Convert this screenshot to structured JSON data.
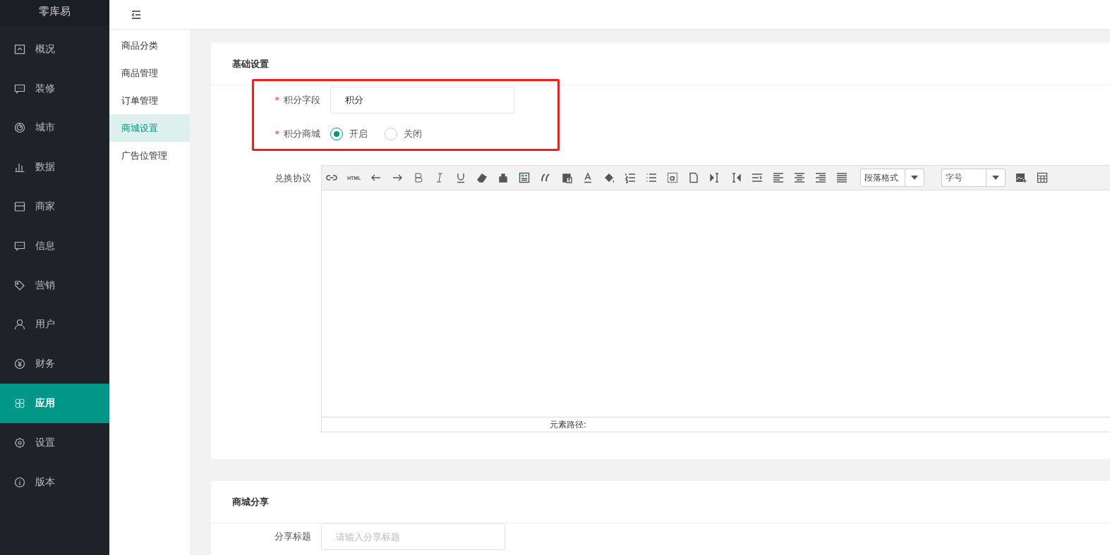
{
  "brand": "零库易",
  "nav": [
    {
      "label": "概况",
      "selected": false
    },
    {
      "label": "装修",
      "selected": false
    },
    {
      "label": "城市",
      "selected": false
    },
    {
      "label": "数据",
      "selected": false
    },
    {
      "label": "商家",
      "selected": false
    },
    {
      "label": "信息",
      "selected": false
    },
    {
      "label": "营销",
      "selected": false
    },
    {
      "label": "用户",
      "selected": false
    },
    {
      "label": "财务",
      "selected": false
    },
    {
      "label": "应用",
      "selected": true
    },
    {
      "label": "设置",
      "selected": false
    },
    {
      "label": "版本",
      "selected": false
    }
  ],
  "subnav": [
    {
      "label": "商品分类",
      "selected": false
    },
    {
      "label": "商品管理",
      "selected": false
    },
    {
      "label": "订单管理",
      "selected": false
    },
    {
      "label": "商城设置",
      "selected": true
    },
    {
      "label": "广告位管理",
      "selected": false
    }
  ],
  "basic": {
    "title": "基础设置",
    "points_field": {
      "label": "积分字段",
      "required_mark": "*",
      "value": "积分"
    },
    "points_mall": {
      "label": "积分商城",
      "required_mark": "*",
      "options": [
        {
          "label": "开启",
          "selected": true
        },
        {
          "label": "关闭",
          "selected": false
        }
      ]
    },
    "agreement": {
      "label": "兑换协议",
      "html_button": "HTML",
      "paragraph_select": "段落格式",
      "size_select": "字号",
      "path_label": "元素路径:"
    }
  },
  "share": {
    "title": "商城分享",
    "share_title": {
      "label": "分享标题",
      "placeholder": "请输入分享标题"
    }
  }
}
